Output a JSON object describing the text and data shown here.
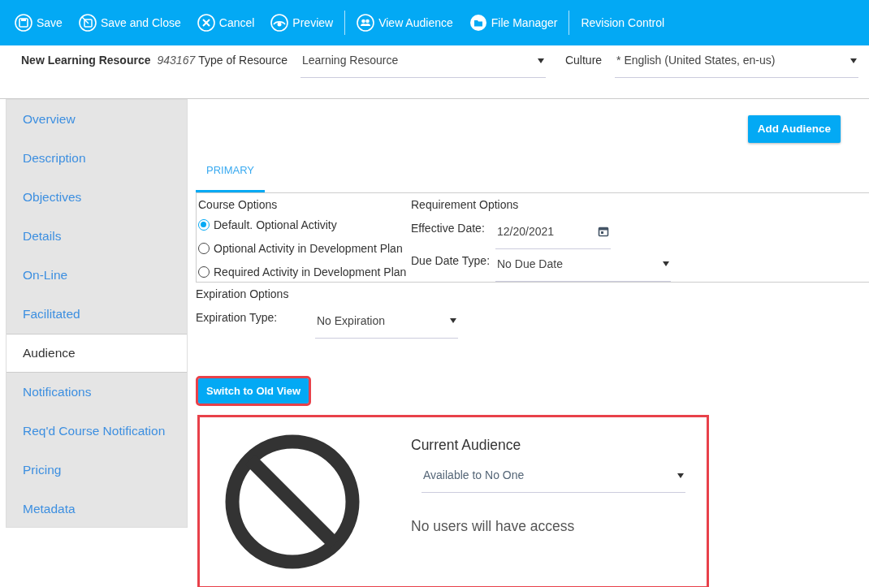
{
  "toolbar": {
    "groups": [
      [
        {
          "kind": "save",
          "label": "Save"
        },
        {
          "kind": "saveclose",
          "label": "Save and Close"
        },
        {
          "kind": "cancel",
          "label": "Cancel"
        },
        {
          "kind": "preview",
          "label": "Preview"
        }
      ],
      [
        {
          "kind": "audience",
          "label": "View Audience"
        },
        {
          "kind": "folder",
          "label": "File Manager"
        }
      ],
      [
        {
          "kind": "text",
          "label": "Revision Control"
        }
      ]
    ]
  },
  "header": {
    "title": "New Learning Resource",
    "id": "943167",
    "type_label": "Type of Resource",
    "type_value": "Learning Resource",
    "culture_label": "Culture",
    "culture_value": "* English (United States, en-us)"
  },
  "sidebar": {
    "items": [
      {
        "label": "Overview",
        "selected": false
      },
      {
        "label": "Description",
        "selected": false
      },
      {
        "label": "Objectives",
        "selected": false
      },
      {
        "label": "Details",
        "selected": false
      },
      {
        "label": "On-Line",
        "selected": false
      },
      {
        "label": "Facilitated",
        "selected": false
      },
      {
        "label": "Audience",
        "selected": true
      },
      {
        "label": "Notifications",
        "selected": false
      },
      {
        "label": "Req'd Course Notification",
        "selected": false
      },
      {
        "label": "Pricing",
        "selected": false
      },
      {
        "label": "Metadata",
        "selected": false
      }
    ]
  },
  "add_button": "Add Audience",
  "tabs": [
    {
      "label": "PRIMARY",
      "selected": true
    }
  ],
  "course_options": {
    "title": "Course Options",
    "options": [
      {
        "label": "Default. Optional Activity",
        "selected": true
      },
      {
        "label": "Optional Activity in Development Plan",
        "selected": false
      },
      {
        "label": "Required Activity in Development Plan",
        "selected": false
      }
    ]
  },
  "requirement_options": {
    "title": "Requirement Options",
    "effective_label": "Effective Date:",
    "effective_value": "12/20/2021",
    "due_label": "Due Date Type:",
    "due_value": "No Due Date"
  },
  "expiration_options": {
    "title": "Expiration Options",
    "type_label": "Expiration Type:",
    "type_value": "No Expiration"
  },
  "switch_button": {
    "label": "Switch to Old View",
    "highlighted": true
  },
  "audience_panel": {
    "highlighted": true,
    "title": "Current Audience",
    "value": "Available to No One",
    "message": "No users will have access"
  }
}
